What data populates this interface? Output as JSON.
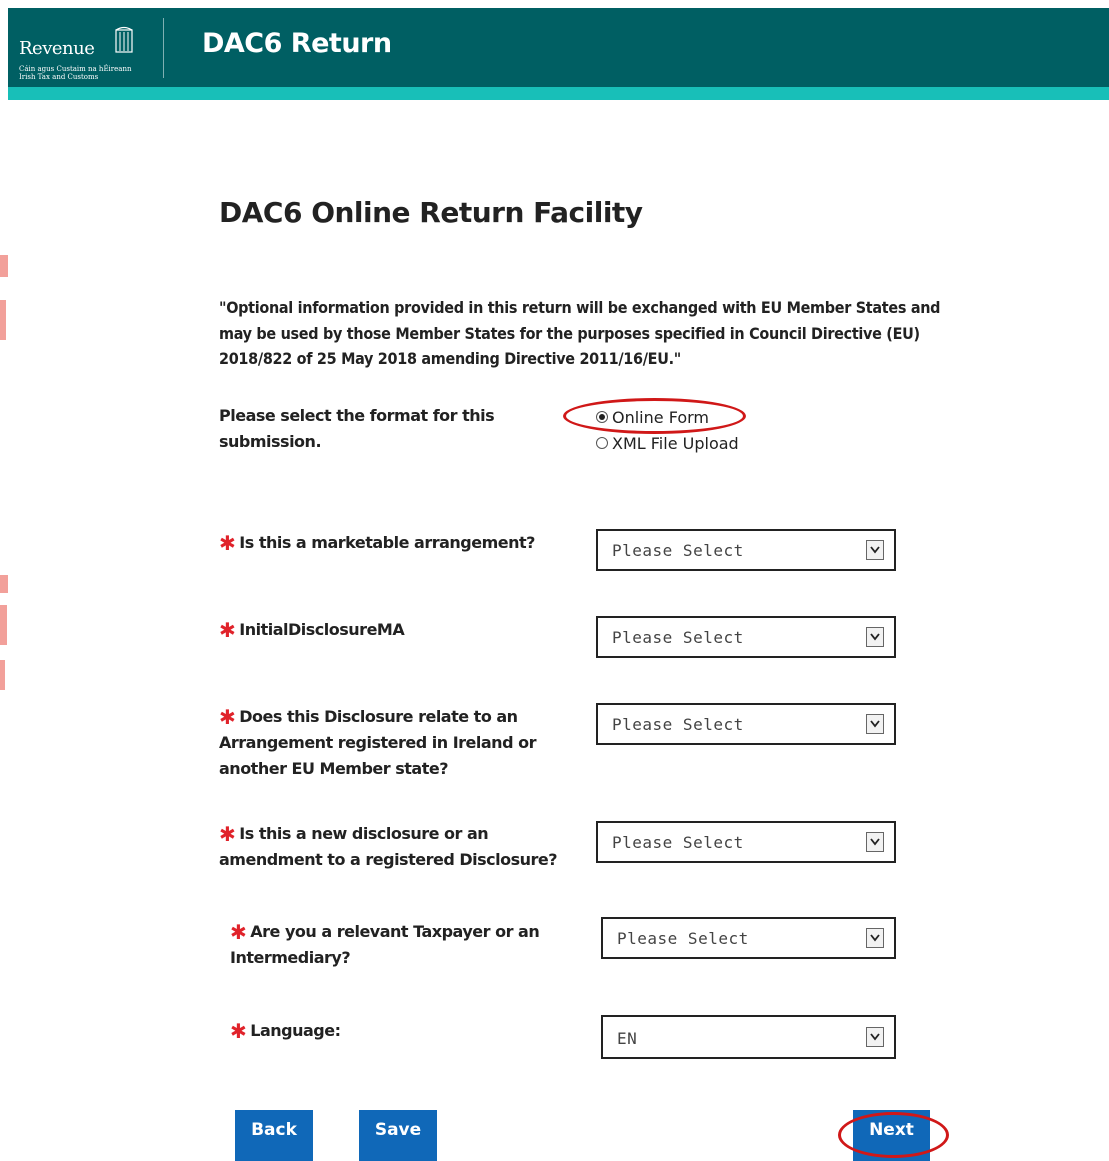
{
  "header": {
    "logo_word": "Revenue",
    "logo_sub_line1": "Cáin agus Custaim na hÉireann",
    "logo_sub_line2": "Irish Tax and Customs",
    "app_title": "DAC6 Return"
  },
  "main": {
    "page_title": "DAC6 Online Return Facility",
    "notice": "\"Optional information provided in this return will be exchanged with EU Member States and may be used by those Member States for the purposes specified in Council Directive (EU) 2018/822 of 25 May 2018 amending Directive 2011/16/EU.\"",
    "format_question": "Please select the format for this submission.",
    "format_options": [
      {
        "label": "Online Form",
        "checked": true
      },
      {
        "label": "XML File Upload",
        "checked": false
      }
    ],
    "required_mark": "✱",
    "questions": [
      {
        "label": "Is this a marketable arrangement?",
        "value": "Please Select"
      },
      {
        "label": "InitialDisclosureMA",
        "value": "Please Select"
      },
      {
        "label": "Does this Disclosure relate to an Arrangement registered in Ireland or another EU Member state?",
        "value": "Please Select"
      },
      {
        "label": "Is this a new disclosure or an amendment to a registered Disclosure?",
        "value": "Please Select"
      },
      {
        "label": "Are you a relevant Taxpayer or an Intermediary?",
        "value": "Please Select"
      },
      {
        "label": "Language:",
        "value": "EN"
      }
    ]
  },
  "buttons": {
    "back": "Back",
    "save": "Save",
    "next": "Next"
  },
  "colors": {
    "header_bg": "#005f63",
    "header_stripe": "#18bfb8",
    "button_bg": "#1068b8",
    "required": "#e0222a",
    "highlight_ellipse": "#d01818"
  }
}
